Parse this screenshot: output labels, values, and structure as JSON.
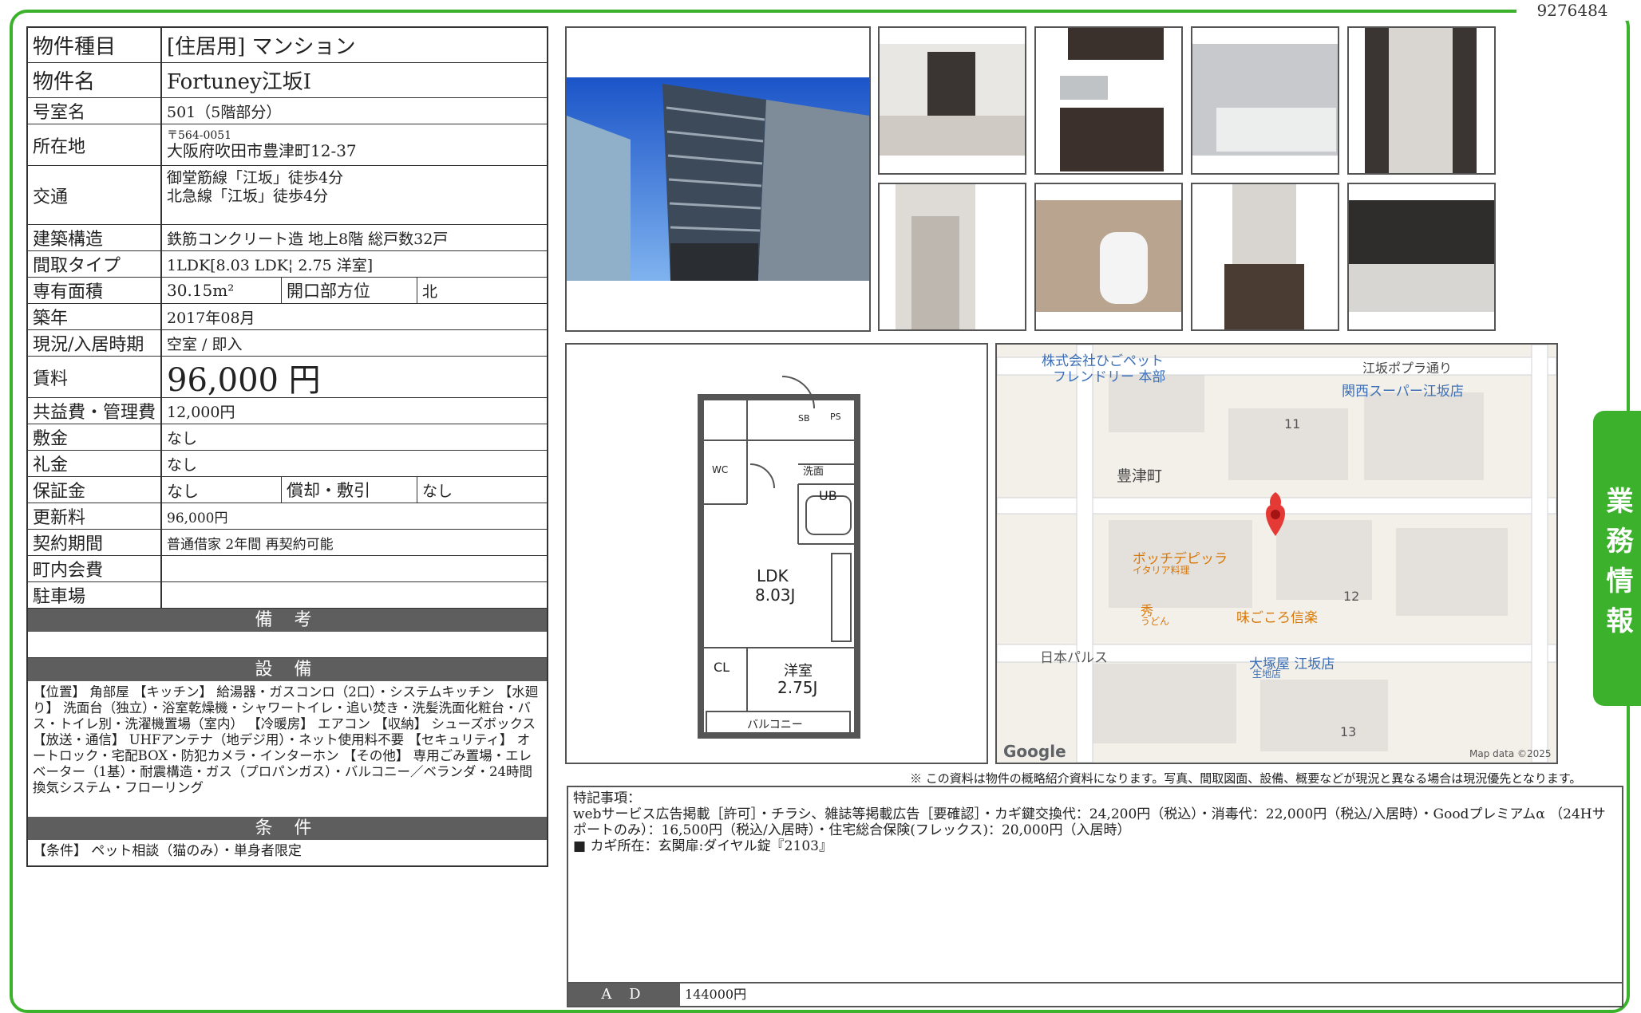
{
  "doc_id": "9276484",
  "side_tab": "業務情報",
  "spec": {
    "type_label": "物件種目",
    "type_value": "[住居用] マンション",
    "name_label": "物件名",
    "name_value": "Fortuney江坂I",
    "room_label": "号室名",
    "room_value": "501（5階部分）",
    "address_label": "所在地",
    "postal": "〒564-0051",
    "address": "大阪府吹田市豊津町12-37",
    "transit_label": "交通",
    "transit_1": "御堂筋線「江坂」徒歩4分",
    "transit_2": "北急線「江坂」徒歩4分",
    "structure_label": "建築構造",
    "structure_value": "鉄筋コンクリート造 地上8階 総戸数32戸",
    "layout_label": "間取タイプ",
    "layout_value": "1LDK[8.03 LDK¦ 2.75 洋室]",
    "area_label": "専有面積",
    "area_value": "30.15m²",
    "facing_label": "開口部方位",
    "facing_value": "北",
    "built_label": "築年",
    "built_value": "2017年08月",
    "status_label": "現況/入居時期",
    "status_value": "空室 / 即入",
    "rent_label": "賃料",
    "rent_value": "96,000 円",
    "fee_label": "共益費・管理費",
    "fee_value": "12,000円",
    "deposit_label": "敷金",
    "deposit_value": "なし",
    "keymoney_label": "礼金",
    "keymoney_value": "なし",
    "guarantee_label": "保証金",
    "guarantee_value": "なし",
    "amort_label": "償却・敷引",
    "amort_value": "なし",
    "renewal_label": "更新料",
    "renewal_value": "96,000円",
    "contract_label": "契約期間",
    "contract_value": "普通借家 2年間 再契約可能",
    "town_label": "町内会費",
    "town_value": "",
    "parking_label": "駐車場",
    "parking_value": ""
  },
  "sections": {
    "remarks_title": "備 考",
    "equipment_title": "設 備",
    "equipment_text": "【位置】 角部屋 【キッチン】 給湯器・ガスコンロ（2口）・システムキッチン 【水廻り】 洗面台（独立）・浴室乾燥機・シャワートイレ・追い焚き・洗髪洗面化粧台・バス・トイレ別・洗濯機置場（室内） 【冷暖房】 エアコン 【収納】 シューズボックス 【放送・通信】 UHFアンテナ（地デジ用）・ネット使用料不要 【セキュリティ】 オートロック・宅配BOX・防犯カメラ・インターホン 【その他】 専用ごみ置場・エレベーター（1基）・耐震構造・ガス（プロパンガス）・バルコニー／ベランダ・24時間換気システム・フローリング",
    "conditions_title": "条 件",
    "conditions_text": "【条件】 ペット相談（猫のみ）・単身者限定"
  },
  "floorplan": {
    "ldk": "LDK",
    "ldk_size": "8.03J",
    "room": "洋室",
    "room_size": "2.75J",
    "wc": "WC",
    "ub": "UB",
    "sb": "SB",
    "ps": "PS",
    "wash": "洗面",
    "cl": "CL",
    "balcony": "バルコニー"
  },
  "map": {
    "company": "株式会社ひごペット",
    "company2": "フレンドリー 本部",
    "street": "江坂ポプラ通り",
    "super": "関西スーパー江坂店",
    "block_11": "11",
    "town": "豊津町",
    "pizza": "ボッチデピッラ",
    "pizza_sub": "イタリア料理",
    "block_12": "12",
    "udon": "秀",
    "udon_sub": "うどん",
    "shinraku": "味ごころ信楽",
    "palace": "日本パルス",
    "otsuka": "大塚屋 江坂店",
    "otsuka_sub": "生地店",
    "block_13": "13",
    "google": "Google",
    "mapdata": "Map data ©2025"
  },
  "note": "※ この資料は物件の概略紹介資料になります。写真、間取図面、設備、概要などが現況と異なる場合は現況優先となります。",
  "remarks": {
    "line1": "特記事項：",
    "line2": "webサービス広告掲載［許可］・チラシ、雑誌等掲載広告［要確認］・カギ鍵交換代：24,200円（税込）・消毒代：22,000円（税込/入居時）・Goodプレミアムα （24Hサポートのみ）：16,500円（税込/入居時）・住宅総合保険(フレックス)：20,000円（入居時）",
    "line3": "■ カギ所在：玄関扉:ダイヤル錠『2103』",
    "ad_label": "A D",
    "ad_value": "144000円"
  }
}
